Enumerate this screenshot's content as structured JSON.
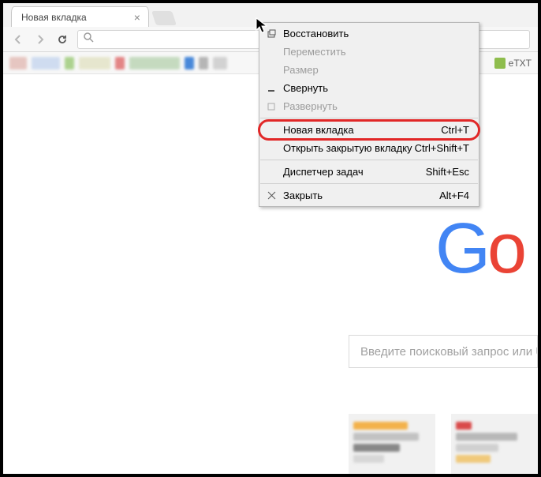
{
  "tab": {
    "title": "Новая вкладка"
  },
  "bookmarks": {
    "right_label": "eTXT"
  },
  "logo": {
    "g": "G",
    "o": "o"
  },
  "search": {
    "placeholder": "Введите поисковый запрос или URL"
  },
  "menu": {
    "restore": {
      "label": "Восстановить"
    },
    "move": {
      "label": "Переместить"
    },
    "size": {
      "label": "Размер"
    },
    "minimize": {
      "label": "Свернуть"
    },
    "maximize": {
      "label": "Развернуть"
    },
    "newtab": {
      "label": "Новая вкладка",
      "shortcut": "Ctrl+T"
    },
    "reopen": {
      "label": "Открыть закрытую вкладку",
      "shortcut": "Ctrl+Shift+T"
    },
    "taskmgr": {
      "label": "Диспетчер задач",
      "shortcut": "Shift+Esc"
    },
    "close": {
      "label": "Закрыть",
      "shortcut": "Alt+F4"
    }
  }
}
